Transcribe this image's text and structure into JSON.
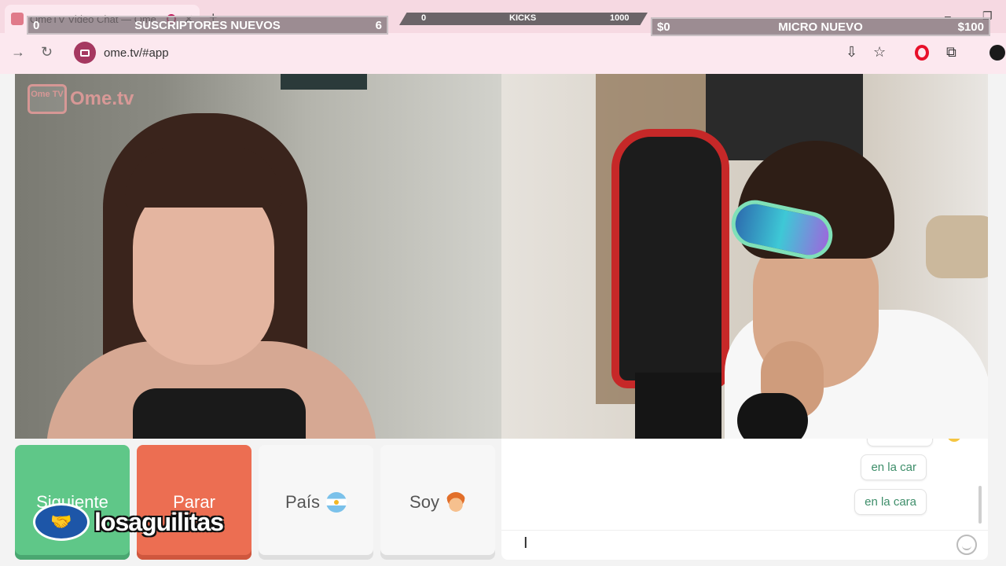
{
  "browser": {
    "tab_title": "OmeTV Video Chat — Ome",
    "tab_close": "✕",
    "new_tab": "+",
    "url": "ome.tv/#app"
  },
  "overlays": {
    "subs": {
      "left": "0",
      "label": "SUSCRIPTORES NUEVOS",
      "right": "6"
    },
    "kicks": {
      "left": "0",
      "label": "KICKS",
      "right": "1000"
    },
    "mic": {
      "left": "$0",
      "label": "MICRO NUEVO",
      "right": "$100"
    }
  },
  "ome_logo": {
    "badge": "Ome TV",
    "word": "Ome.tv"
  },
  "buttons": {
    "next": "Siguiente",
    "stop": "Parar",
    "country": "País",
    "iam": "Soy"
  },
  "watermark": {
    "text": "losaguilitas"
  },
  "chat": {
    "messages": [
      "en la car",
      "en la cara"
    ],
    "input_value": ""
  },
  "colors": {
    "next": "#5fc788",
    "stop": "#ec6e52",
    "chat_text": "#3e8e6a",
    "chrome_bg": "#fce8ef"
  }
}
